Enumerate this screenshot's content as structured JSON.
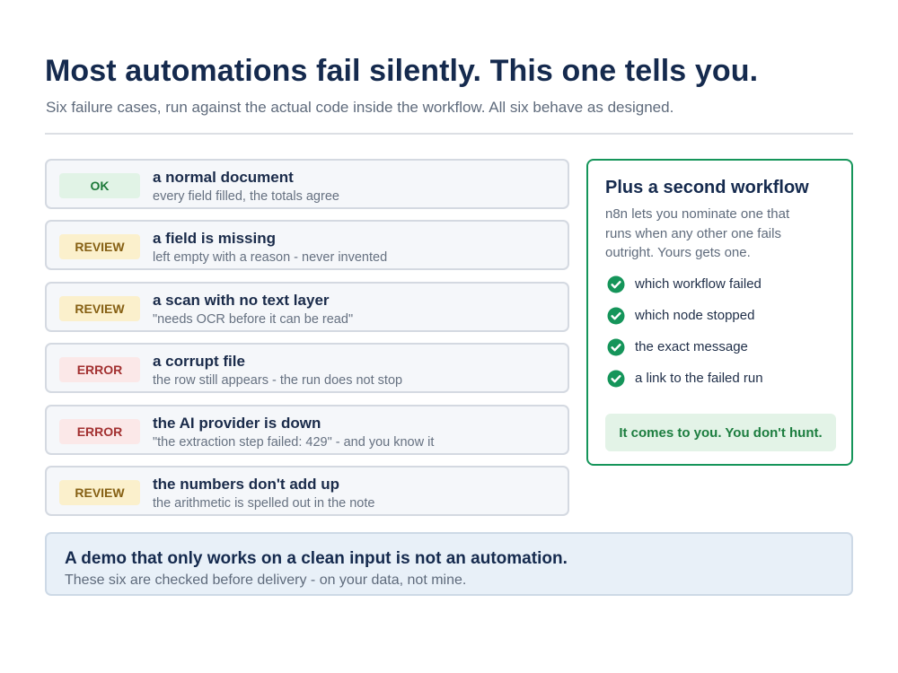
{
  "header": {
    "title": "Most automations fail silently. This one tells you.",
    "subtitle": "Six failure cases, run against the actual code inside the workflow. All six behave as designed."
  },
  "cases": [
    {
      "status": "OK",
      "status_kind": "ok",
      "title": "a normal document",
      "description": "every field filled, the totals agree"
    },
    {
      "status": "REVIEW",
      "status_kind": "review",
      "title": "a field is missing",
      "description": "left empty with a reason - never invented"
    },
    {
      "status": "REVIEW",
      "status_kind": "review",
      "title": "a scan with no text layer",
      "description": "\"needs OCR before it can be read\""
    },
    {
      "status": "ERROR",
      "status_kind": "error",
      "title": "a corrupt file",
      "description": "the row still appears - the run does not stop"
    },
    {
      "status": "ERROR",
      "status_kind": "error",
      "title": "the AI provider is down",
      "description": "\"the extraction step failed: 429\" - and you know it"
    },
    {
      "status": "REVIEW",
      "status_kind": "review",
      "title": "the numbers don't add up",
      "description": "the arithmetic is spelled out in the note"
    }
  ],
  "side_panel": {
    "title": "Plus a second workflow",
    "description": "n8n lets you nominate one that runs when any other one fails outright. Yours gets one.",
    "items": [
      {
        "icon": "check-circle-icon",
        "label": "which workflow failed"
      },
      {
        "icon": "check-circle-icon",
        "label": "which node stopped"
      },
      {
        "icon": "check-circle-icon",
        "label": "the exact message"
      },
      {
        "icon": "check-circle-icon",
        "label": "a link to the failed run"
      }
    ],
    "callout": "It comes to you. You don't hunt."
  },
  "footer": {
    "title": "A demo that only works on a clean input is not an automation.",
    "description": "These six are checked before delivery - on your data, not mine."
  },
  "colors": {
    "ok": "#1e7a3a",
    "review": "#866014",
    "error": "#a23030",
    "accent_green": "#15955a",
    "navy": "#152a4e"
  }
}
